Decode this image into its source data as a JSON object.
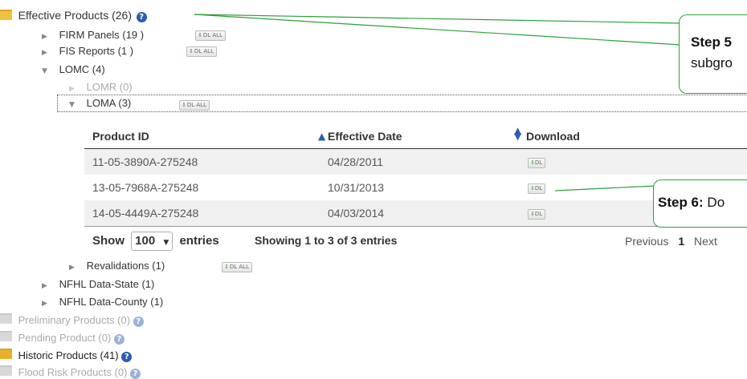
{
  "tree": {
    "effective": {
      "label": "Effective Products (26)",
      "help": "?"
    },
    "firm": {
      "label": "FIRM Panels (19 )",
      "dlall": "DL ALL"
    },
    "fis": {
      "label": "FIS Reports (1 )",
      "dlall": "DL ALL"
    },
    "lomc": {
      "label": "LOMC (4)"
    },
    "lomr": {
      "label": "LOMR (0)"
    },
    "loma": {
      "label": "LOMA (3)",
      "dlall": "DL ALL"
    },
    "revalidations": {
      "label": "Revalidations (1)",
      "dlall": "DL ALL"
    },
    "nfhl_state": {
      "label": "NFHL Data-State (1)"
    },
    "nfhl_county": {
      "label": "NFHL Data-County (1)"
    },
    "preliminary": {
      "label": "Preliminary Products (0)",
      "help": "?"
    },
    "pending": {
      "label": "Pending Product (0)",
      "help": "?"
    },
    "historic": {
      "label": "Historic Products (41)",
      "help": "?"
    },
    "flood_risk": {
      "label": "Flood Risk Products (0)",
      "help": "?"
    }
  },
  "table": {
    "headers": {
      "product_id": "Product ID",
      "effective_date": "Effective Date",
      "download": "Download"
    },
    "rows": [
      {
        "product_id": "11-05-3890A-275248",
        "effective_date": "04/28/2011",
        "download": "DL"
      },
      {
        "product_id": "13-05-7968A-275248",
        "effective_date": "10/31/2013",
        "download": "DL"
      },
      {
        "product_id": "14-05-4449A-275248",
        "effective_date": "04/03/2014",
        "download": "DL"
      }
    ],
    "show_label": "Show",
    "entries_value": "100",
    "entries_label": "entries",
    "info": "Showing 1 to 3 of 3 entries",
    "pagination": {
      "previous": "Previous",
      "page": "1",
      "next": "Next"
    }
  },
  "callouts": {
    "step5_title": "Step 5",
    "step5_text": "subgro",
    "step6_title": "Step 6:",
    "step6_text": "Do"
  },
  "colors": {
    "callout_border": "#2e9e3e",
    "help_icon": "#2a5db0",
    "folder": "#f0c040"
  }
}
